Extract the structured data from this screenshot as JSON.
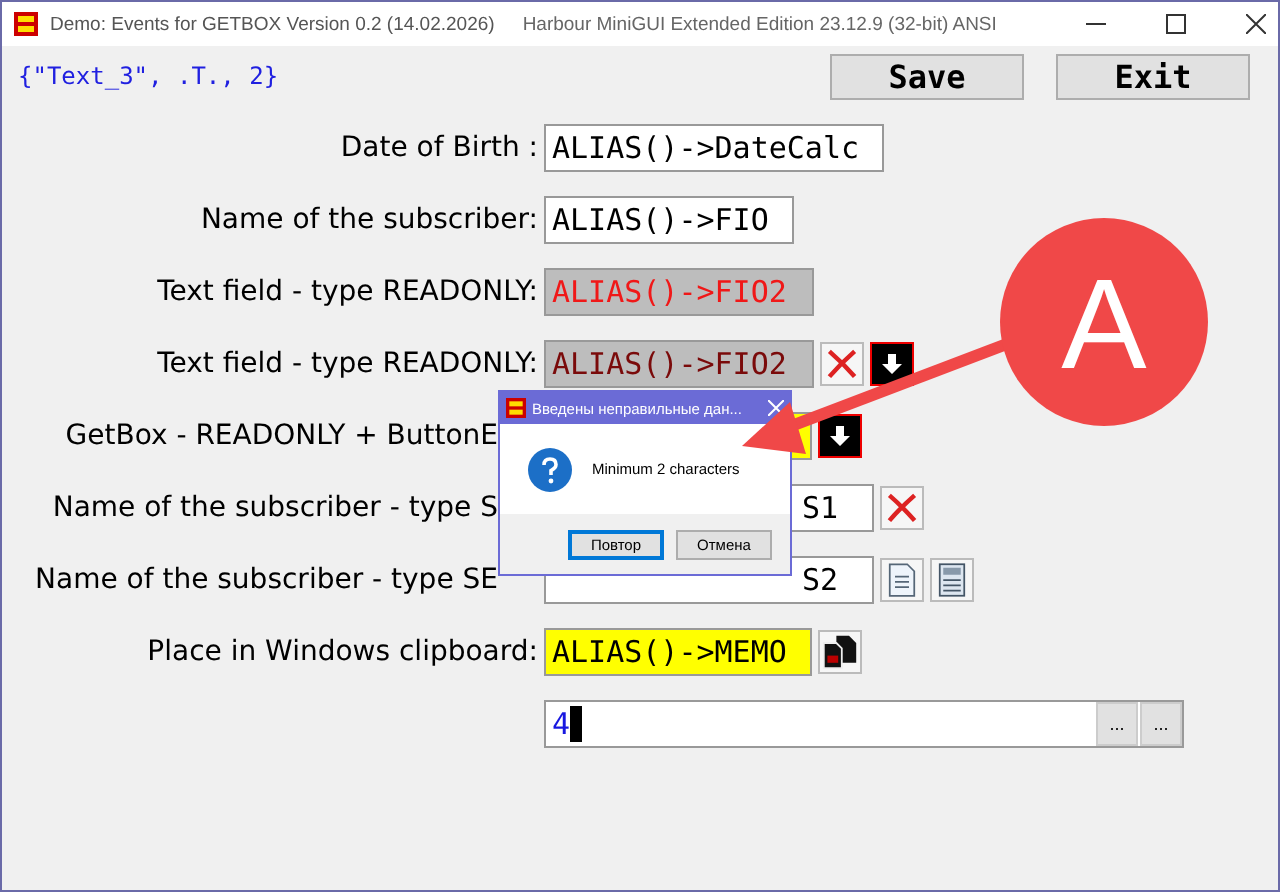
{
  "window": {
    "title": "Demo: Events for GETBOX Version 0.2 (14.02.2026)",
    "subtitle": "Harbour MiniGUI Extended Edition 23.12.9 (32-bit) ANSI"
  },
  "info": "{\"Text_3\", .T., 2}",
  "buttons": [
    "Save",
    "Exit"
  ],
  "rows": [
    {
      "label": "Date of Birth :",
      "field": {
        "kind": "normal",
        "value": "ALIAS()->DateCalc"
      },
      "actions": []
    },
    {
      "label": "Name of the subscriber:",
      "field": {
        "kind": "short",
        "value": "ALIAS()->FIO"
      },
      "actions": []
    },
    {
      "label": "Text field - type READONLY:",
      "field": {
        "kind": "readonly",
        "value": "ALIAS()->FIO2"
      },
      "actions": []
    },
    {
      "label": "Text field - type READONLY:",
      "field": {
        "kind": "readonly-dark",
        "value": "ALIAS()->FIO2"
      },
      "actions": [
        {
          "kind": "clear"
        },
        {
          "kind": "down"
        }
      ]
    },
    {
      "label": "GetBox - READONLY + ButtonE",
      "field": {
        "kind": "highlight"
      },
      "actions": [
        {
          "kind": "down"
        }
      ]
    },
    {
      "label": "Name of the subscriber - type S",
      "field": {
        "kind": "tail",
        "value": "S1"
      },
      "actions": [
        {
          "kind": "clear"
        }
      ]
    },
    {
      "label": "Name of the subscriber - type SE",
      "field": {
        "kind": "tail",
        "value": "S2"
      },
      "actions": [
        {
          "kind": "doc"
        },
        {
          "kind": "calc"
        }
      ]
    },
    {
      "label": "Place in Windows clipboard:",
      "field": {
        "kind": "highlight",
        "value": "ALIAS()->MEMO"
      },
      "actions": [
        {
          "kind": "copy"
        }
      ]
    },
    {
      "field": {
        "kind": "wide",
        "value": "4",
        "cursor": true
      },
      "actions": [
        {
          "kind": "dots",
          "text": "..."
        },
        {
          "kind": "dots",
          "text": "..."
        }
      ]
    }
  ],
  "dialog": {
    "title": "Введены неправильные дан...",
    "message": "Minimum 2 characters",
    "buttons": [
      {
        "label": "Повтор",
        "selected": true
      },
      {
        "label": "Отмена",
        "selected": false
      }
    ]
  },
  "annotation": {
    "letter": "A"
  }
}
